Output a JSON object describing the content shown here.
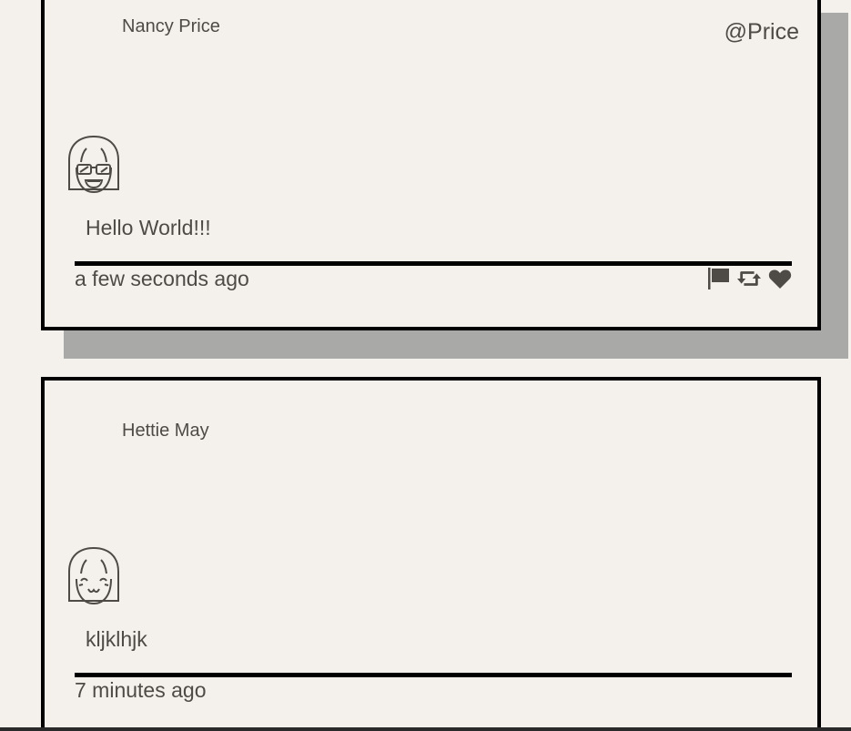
{
  "tweets": [
    {
      "author": "Nancy Price",
      "handle": "@Price",
      "content": "Hello World!!!",
      "time": "a few seconds ago",
      "avatar_icon": "girl-sunglasses-avatar-icon",
      "actions": [
        "flag-icon",
        "retweet-icon",
        "heart-icon"
      ]
    },
    {
      "author": "Hettie May",
      "content": "kljklhjk",
      "time": "7 minutes ago",
      "avatar_icon": "girl-smiling-avatar-icon"
    }
  ],
  "colors": {
    "background": "#f4f1ec",
    "text": "#4e4b46",
    "border": "#000000",
    "shadow": "#a9a9a7"
  }
}
